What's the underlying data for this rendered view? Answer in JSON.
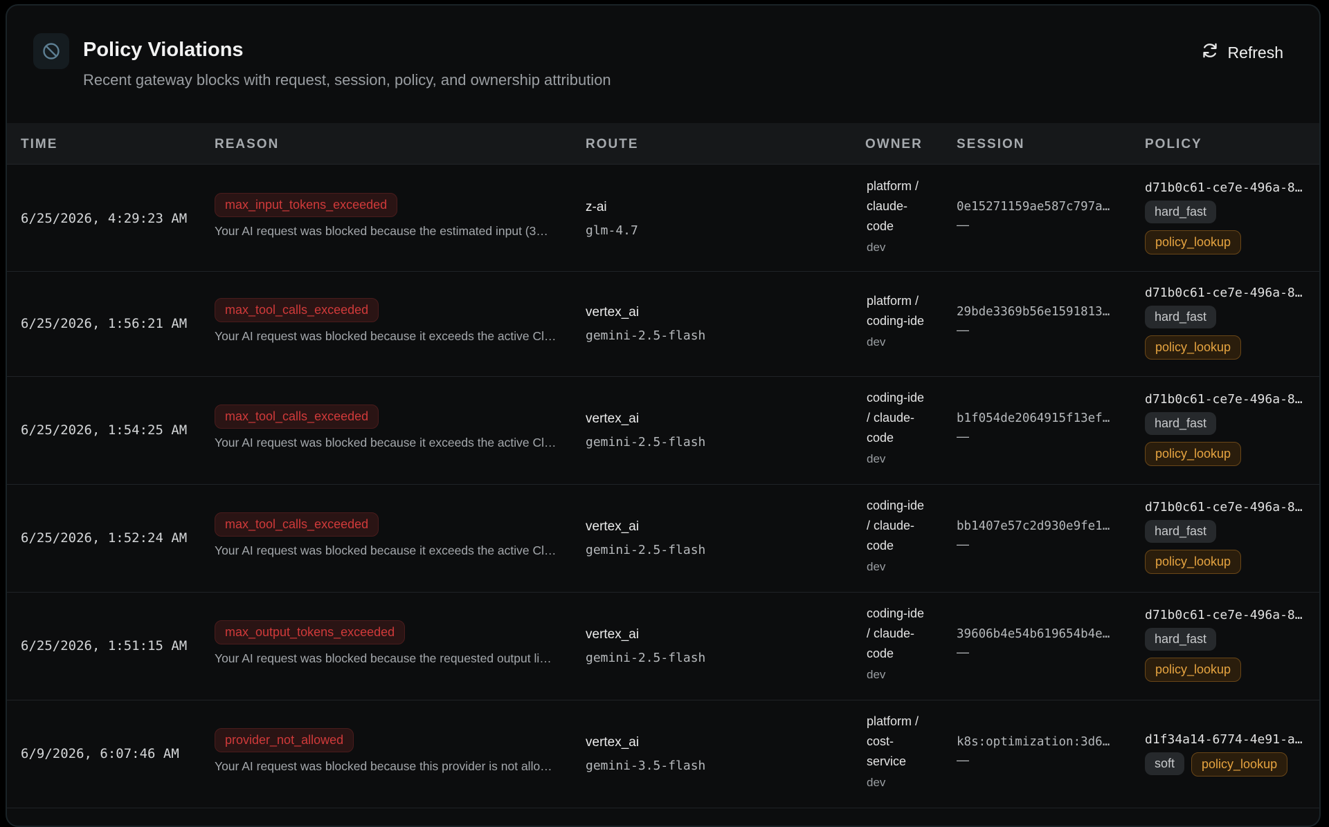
{
  "header": {
    "title": "Policy Violations",
    "subtitle": "Recent gateway blocks with request, session, policy, and ownership attribution",
    "refresh_label": "Refresh",
    "icon": "blocked-circle-icon"
  },
  "columns": {
    "time": "TIME",
    "reason": "REASON",
    "route": "ROUTE",
    "owner": "OWNER",
    "session": "SESSION",
    "policy": "POLICY"
  },
  "colors": {
    "background": "#0c0d0e",
    "reason_badge": "#d03a3a",
    "source_badge": "#e6a440",
    "mode_badge": "#26292c"
  },
  "rows": [
    {
      "time": "6/25/2026, 4:29:23 AM",
      "reason_code": "max_input_tokens_exceeded",
      "reason_text": "Your AI request was blocked because the estimated input (3…",
      "provider": "z-ai",
      "model": "glm-4.7",
      "owner_l1": "platform /",
      "owner_l2": "claude-",
      "owner_l3": "code",
      "env": "dev",
      "session_id": "0e15271159ae587c797a…",
      "session_dash": "—",
      "policy_id": "d71b0c61-ce7e-496a-8…",
      "mode": "hard_fast",
      "source": "policy_lookup"
    },
    {
      "time": "6/25/2026, 1:56:21 AM",
      "reason_code": "max_tool_calls_exceeded",
      "reason_text": "Your AI request was blocked because it exceeds the active Cl…",
      "provider": "vertex_ai",
      "model": "gemini-2.5-flash",
      "owner_l1": "platform /",
      "owner_l2": "coding-ide",
      "owner_l3": "",
      "env": "dev",
      "session_id": "29bde3369b56e1591813…",
      "session_dash": "—",
      "policy_id": "d71b0c61-ce7e-496a-8…",
      "mode": "hard_fast",
      "source": "policy_lookup"
    },
    {
      "time": "6/25/2026, 1:54:25 AM",
      "reason_code": "max_tool_calls_exceeded",
      "reason_text": "Your AI request was blocked because it exceeds the active Cl…",
      "provider": "vertex_ai",
      "model": "gemini-2.5-flash",
      "owner_l1": "coding-ide",
      "owner_l2": "/ claude-",
      "owner_l3": "code",
      "env": "dev",
      "session_id": "b1f054de2064915f13ef…",
      "session_dash": "—",
      "policy_id": "d71b0c61-ce7e-496a-8…",
      "mode": "hard_fast",
      "source": "policy_lookup"
    },
    {
      "time": "6/25/2026, 1:52:24 AM",
      "reason_code": "max_tool_calls_exceeded",
      "reason_text": "Your AI request was blocked because it exceeds the active Cl…",
      "provider": "vertex_ai",
      "model": "gemini-2.5-flash",
      "owner_l1": "coding-ide",
      "owner_l2": "/ claude-",
      "owner_l3": "code",
      "env": "dev",
      "session_id": "bb1407e57c2d930e9fe1…",
      "session_dash": "—",
      "policy_id": "d71b0c61-ce7e-496a-8…",
      "mode": "hard_fast",
      "source": "policy_lookup"
    },
    {
      "time": "6/25/2026, 1:51:15 AM",
      "reason_code": "max_output_tokens_exceeded",
      "reason_text": "Your AI request was blocked because the requested output li…",
      "provider": "vertex_ai",
      "model": "gemini-2.5-flash",
      "owner_l1": "coding-ide",
      "owner_l2": "/ claude-",
      "owner_l3": "code",
      "env": "dev",
      "session_id": "39606b4e54b619654b4e…",
      "session_dash": "—",
      "policy_id": "d71b0c61-ce7e-496a-8…",
      "mode": "hard_fast",
      "source": "policy_lookup"
    },
    {
      "time": "6/9/2026, 6:07:46 AM",
      "reason_code": "provider_not_allowed",
      "reason_text": "Your AI request was blocked because this provider is not allo…",
      "provider": "vertex_ai",
      "model": "gemini-3.5-flash",
      "owner_l1": "platform /",
      "owner_l2": "cost-",
      "owner_l3": "service",
      "env": "dev",
      "session_id": "k8s:optimization:3d6…",
      "session_dash": "—",
      "policy_id": "d1f34a14-6774-4e91-a…",
      "mode": "soft",
      "source": "policy_lookup"
    }
  ]
}
